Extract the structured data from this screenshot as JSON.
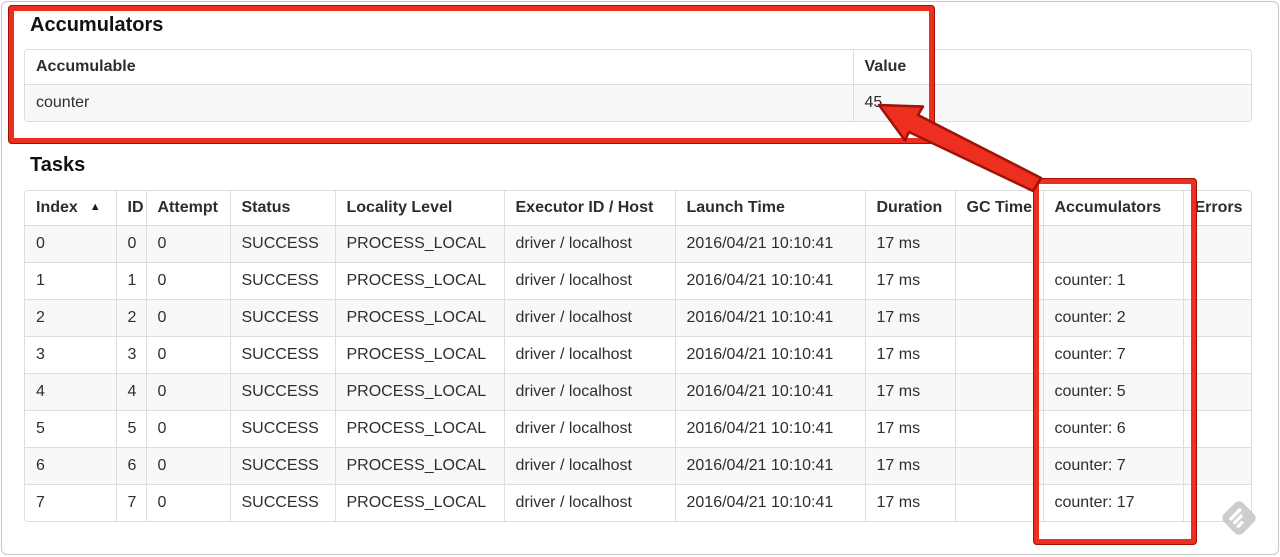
{
  "accumulators": {
    "title": "Accumulators",
    "table": {
      "headers": [
        "Accumulable",
        "Value"
      ],
      "rows": [
        [
          "counter",
          "45"
        ]
      ]
    }
  },
  "tasks": {
    "title": "Tasks",
    "table": {
      "headers": [
        {
          "label": "Index",
          "sort": "▲"
        },
        {
          "label": "ID"
        },
        {
          "label": "Attempt"
        },
        {
          "label": "Status"
        },
        {
          "label": "Locality Level"
        },
        {
          "label": "Executor ID / Host"
        },
        {
          "label": "Launch Time"
        },
        {
          "label": "Duration"
        },
        {
          "label": "GC Time"
        },
        {
          "label": "Accumulators"
        },
        {
          "label": "Errors"
        }
      ],
      "rows": [
        [
          "0",
          "0",
          "0",
          "SUCCESS",
          "PROCESS_LOCAL",
          "driver / localhost",
          "2016/04/21 10:10:41",
          "17 ms",
          "",
          "",
          ""
        ],
        [
          "1",
          "1",
          "0",
          "SUCCESS",
          "PROCESS_LOCAL",
          "driver / localhost",
          "2016/04/21 10:10:41",
          "17 ms",
          "",
          "counter: 1",
          ""
        ],
        [
          "2",
          "2",
          "0",
          "SUCCESS",
          "PROCESS_LOCAL",
          "driver / localhost",
          "2016/04/21 10:10:41",
          "17 ms",
          "",
          "counter: 2",
          ""
        ],
        [
          "3",
          "3",
          "0",
          "SUCCESS",
          "PROCESS_LOCAL",
          "driver / localhost",
          "2016/04/21 10:10:41",
          "17 ms",
          "",
          "counter: 7",
          ""
        ],
        [
          "4",
          "4",
          "0",
          "SUCCESS",
          "PROCESS_LOCAL",
          "driver / localhost",
          "2016/04/21 10:10:41",
          "17 ms",
          "",
          "counter: 5",
          ""
        ],
        [
          "5",
          "5",
          "0",
          "SUCCESS",
          "PROCESS_LOCAL",
          "driver / localhost",
          "2016/04/21 10:10:41",
          "17 ms",
          "",
          "counter: 6",
          ""
        ],
        [
          "6",
          "6",
          "0",
          "SUCCESS",
          "PROCESS_LOCAL",
          "driver / localhost",
          "2016/04/21 10:10:41",
          "17 ms",
          "",
          "counter: 7",
          ""
        ],
        [
          "7",
          "7",
          "0",
          "SUCCESS",
          "PROCESS_LOCAL",
          "driver / localhost",
          "2016/04/21 10:10:41",
          "17 ms",
          "",
          "counter: 17",
          ""
        ]
      ]
    }
  },
  "annotations": {
    "highlight_color": "#ee2f20",
    "outline_color": "#9e1207",
    "arrow_target_value": "45"
  },
  "watermark": {
    "icon": "skitch-watermark",
    "color": "#c9c9c9"
  }
}
